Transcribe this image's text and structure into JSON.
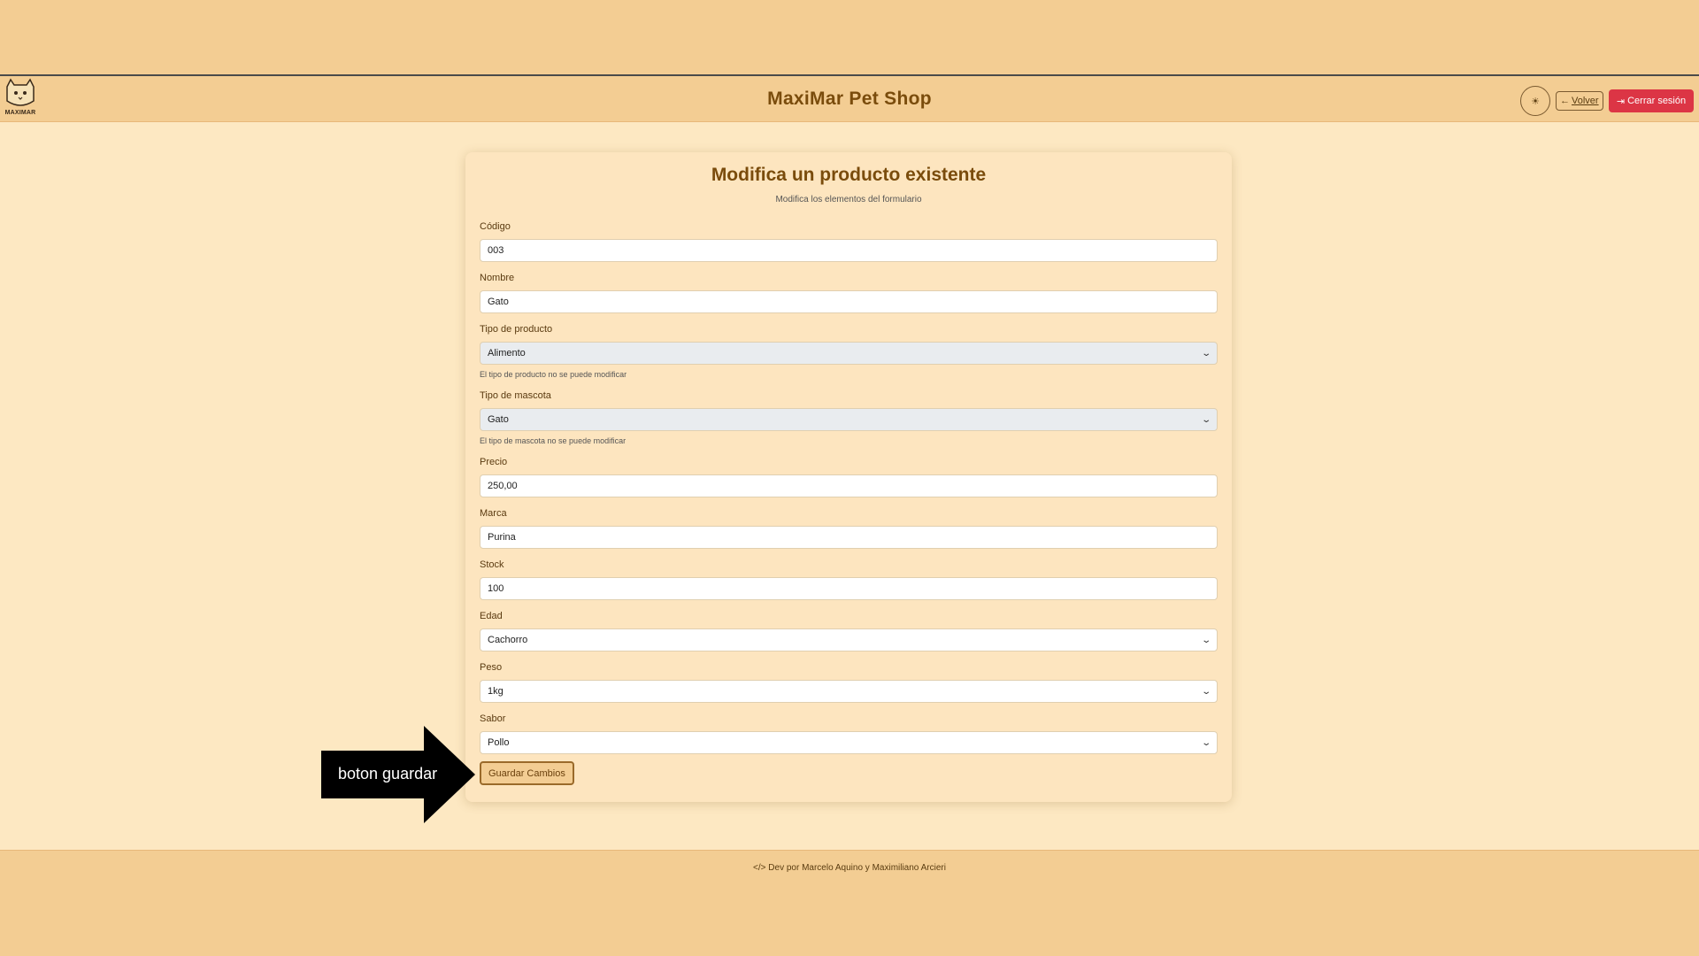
{
  "header": {
    "logo_text": "MAXIMAR",
    "title": "MaxiMar Pet Shop",
    "theme_icon": "sun-icon",
    "back_label": "Volver",
    "logout_label": "Cerrar sesión"
  },
  "form": {
    "title": "Modifica un producto existente",
    "subtitle": "Modifica los elementos del formulario",
    "fields": {
      "codigo": {
        "label": "Código",
        "value": "003"
      },
      "nombre": {
        "label": "Nombre",
        "value": "Gato"
      },
      "tipo_producto": {
        "label": "Tipo de producto",
        "value": "Alimento",
        "help": "El tipo de producto no se puede modificar"
      },
      "tipo_mascota": {
        "label": "Tipo de mascota",
        "value": "Gato",
        "help": "El tipo de mascota no se puede modificar"
      },
      "precio": {
        "label": "Precio",
        "value": "250,00"
      },
      "marca": {
        "label": "Marca",
        "value": "Purina"
      },
      "stock": {
        "label": "Stock",
        "value": "100"
      },
      "edad": {
        "label": "Edad",
        "value": "Cachorro"
      },
      "peso": {
        "label": "Peso",
        "value": "1kg"
      },
      "sabor": {
        "label": "Sabor",
        "value": "Pollo"
      }
    },
    "save_label": "Guardar Cambios"
  },
  "annotation": {
    "arrow_label": "boton guardar"
  },
  "footer": {
    "text": "Dev por Marcelo Aquino y Maximiliano Arcieri"
  },
  "colors": {
    "brand": "#7a4c0c",
    "background": "#f3cd93",
    "content_bg": "#fde8c2",
    "logout": "#dc3545"
  }
}
